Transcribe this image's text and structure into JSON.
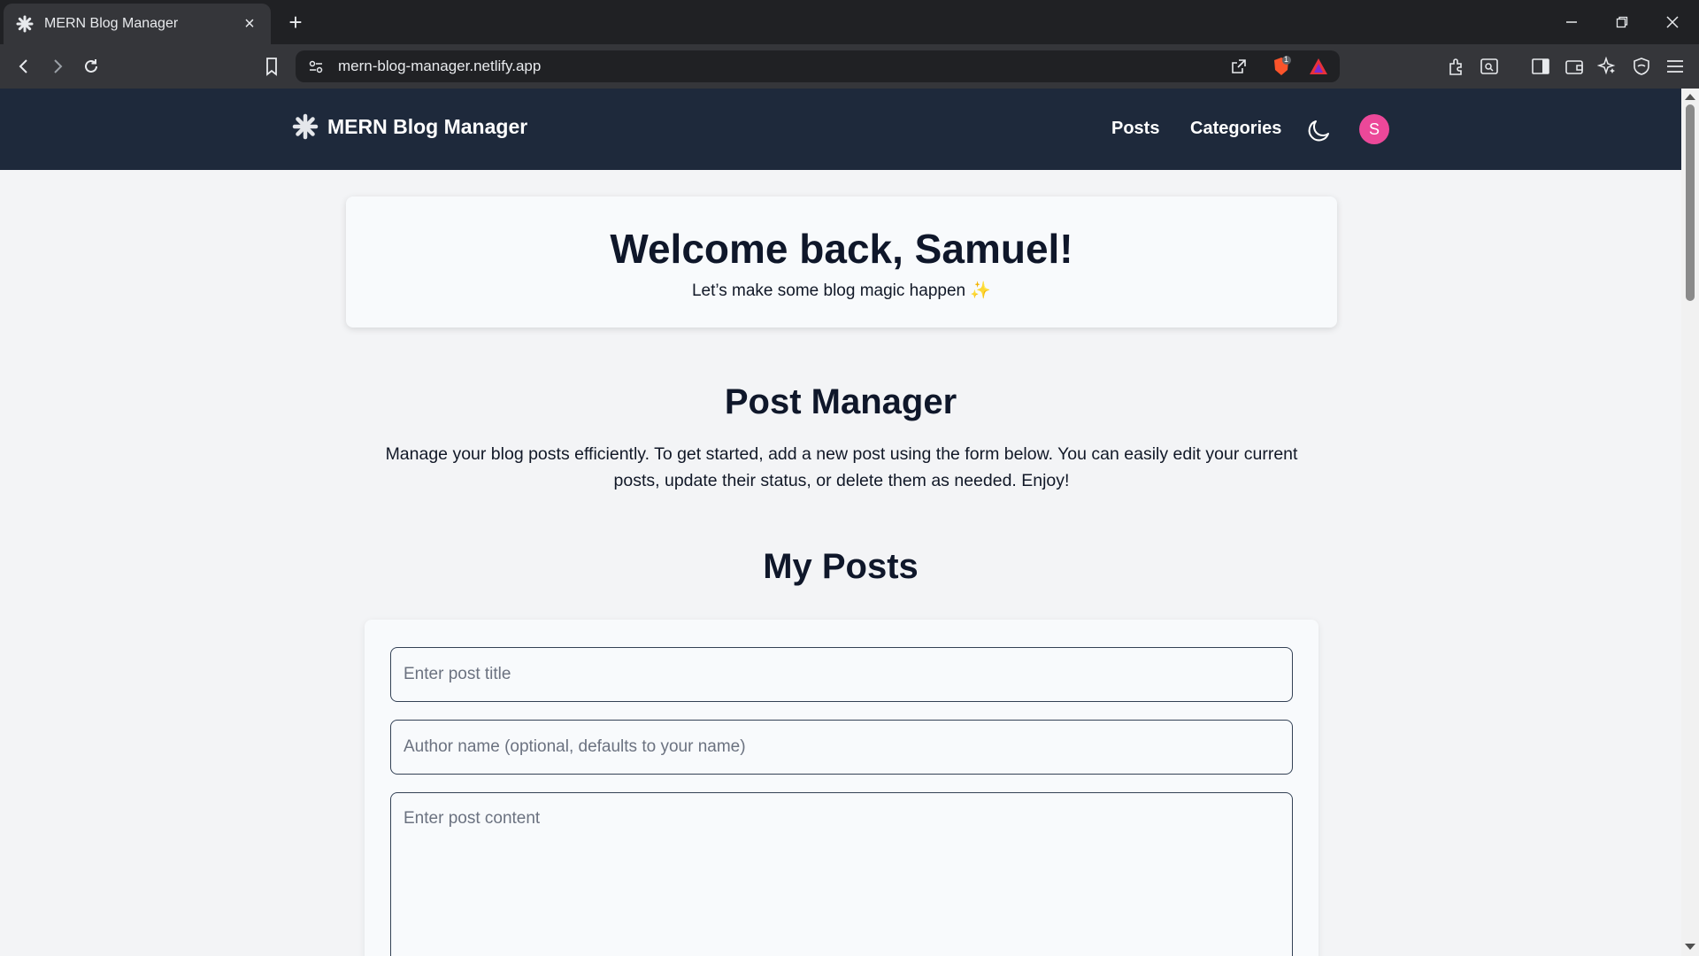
{
  "browser": {
    "tab_title": "MERN Blog Manager",
    "url": "mern-blog-manager.netlify.app",
    "brave_badge": "1"
  },
  "header": {
    "brand": "MERN Blog Manager",
    "nav": [
      "Posts",
      "Categories"
    ],
    "avatar_initial": "S",
    "avatar_color": "#ec4899",
    "background_color": "#1e293b"
  },
  "welcome": {
    "title": "Welcome back, Samuel!",
    "subtitle": "Let’s make some blog magic happen ✨"
  },
  "post_manager": {
    "title": "Post Manager",
    "description": "Manage your blog posts efficiently. To get started, add a new post using the form below. You can easily edit your current posts, update their status, or delete them as needed. Enjoy!"
  },
  "my_posts": {
    "title": "My Posts"
  },
  "form": {
    "title_placeholder": "Enter post title",
    "author_placeholder": "Author name (optional, defaults to your name)",
    "content_placeholder": "Enter post content"
  }
}
